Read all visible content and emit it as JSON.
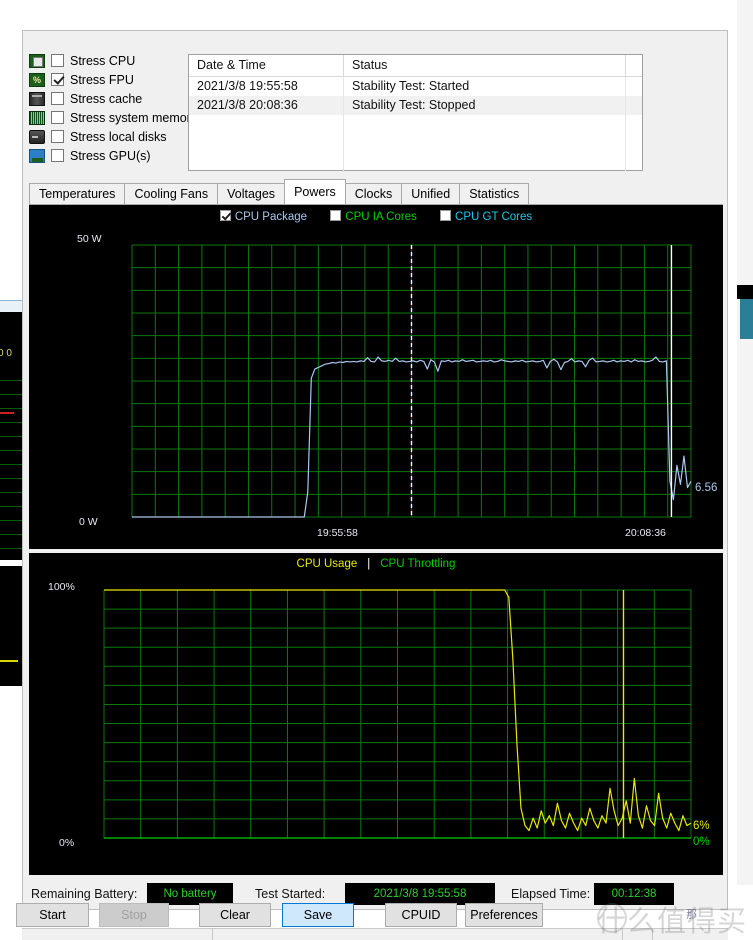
{
  "stress_options": [
    {
      "label": "Stress CPU",
      "checked": false,
      "icon": "cpu-icon"
    },
    {
      "label": "Stress FPU",
      "checked": true,
      "icon": "fpu-icon"
    },
    {
      "label": "Stress cache",
      "checked": false,
      "icon": "cache-icon"
    },
    {
      "label": "Stress system memory",
      "checked": false,
      "icon": "memory-icon"
    },
    {
      "label": "Stress local disks",
      "checked": false,
      "icon": "disk-icon"
    },
    {
      "label": "Stress GPU(s)",
      "checked": false,
      "icon": "gpu-icon"
    }
  ],
  "log": {
    "columns": [
      "Date & Time",
      "Status",
      ""
    ],
    "rows": [
      [
        "2021/3/8 19:55:58",
        "Stability Test: Started",
        ""
      ],
      [
        "2021/3/8 20:08:36",
        "Stability Test: Stopped",
        ""
      ],
      [
        "",
        "",
        ""
      ],
      [
        "",
        "",
        ""
      ],
      [
        "",
        "",
        ""
      ]
    ]
  },
  "tabs": [
    {
      "label": "Temperatures",
      "active": false
    },
    {
      "label": "Cooling Fans",
      "active": false
    },
    {
      "label": "Voltages",
      "active": false
    },
    {
      "label": "Powers",
      "active": true
    },
    {
      "label": "Clocks",
      "active": false
    },
    {
      "label": "Unified",
      "active": false
    },
    {
      "label": "Statistics",
      "active": false
    }
  ],
  "colors": {
    "cpu_package": "#a8c8f0",
    "cpu_ia_cores": "#00d000",
    "cpu_gt_cores": "#20c8f0",
    "cpu_usage": "#e8e800",
    "cpu_throttling": "#00d000",
    "grid": "#0a7a0a",
    "plot_bg": "#000000",
    "axis_text": "#e9e9f5"
  },
  "chart_data": [
    {
      "type": "line",
      "title": "Powers",
      "ylabel": "W",
      "ylim": [
        0,
        50
      ],
      "y_ticks": [
        "0 W",
        "50 W"
      ],
      "x_ticks": [
        "19:55:58",
        "20:08:36"
      ],
      "grid": true,
      "legend": [
        {
          "label": "CPU Package",
          "checked": true,
          "color": "#a8c8f0"
        },
        {
          "label": "CPU IA Cores",
          "checked": false,
          "color": "#00d000"
        },
        {
          "label": "CPU GT Cores",
          "checked": false,
          "color": "#20c8f0"
        }
      ],
      "series": [
        {
          "name": "CPU Package",
          "color": "#a8c8f0",
          "current_value_label": "6.56",
          "values": [
            0,
            0,
            0,
            0,
            0,
            0,
            0,
            0,
            0,
            0,
            0,
            0,
            0,
            0,
            0,
            0,
            0,
            0,
            0,
            0,
            0,
            0,
            0,
            0,
            0,
            0,
            0,
            0,
            0,
            0,
            0,
            0,
            0,
            0,
            0,
            0,
            0,
            0,
            0,
            0,
            0,
            0,
            0,
            0,
            0,
            0,
            0,
            0,
            0,
            0,
            4.6,
            25.5,
            27.2,
            27.5,
            27.8,
            28.1,
            28.2,
            28.4,
            28.3,
            28.5,
            28.4,
            28.6,
            28.5,
            28.6,
            28.5,
            28.7,
            28.6,
            29.3,
            28.6,
            28.5,
            29.4,
            28.7,
            28.6,
            28.8,
            28.6,
            29.2,
            28.6,
            28.7,
            28.5,
            28.6,
            28.7,
            28.5,
            28.8,
            28.6,
            27.2,
            28.9,
            28.5,
            26.8,
            28.7,
            28.6,
            28.8,
            28.5,
            28.7,
            28.6,
            28.9,
            28.6,
            28.7,
            28.8,
            28.5,
            28.6,
            28.7,
            28.6,
            28.8,
            28.5,
            28.6,
            28.9,
            28.7,
            28.6,
            28.5,
            28.7,
            28.6,
            28.8,
            28.5,
            28.6,
            28.7,
            28.5,
            28.6,
            28.8,
            27.4,
            28.6,
            29.0,
            28.5,
            27.1,
            28.4,
            28.6,
            29.1,
            28.5,
            28.7,
            28.6,
            27.6,
            28.8,
            29.2,
            28.5,
            28.6,
            28.7,
            28.5,
            28.6,
            28.8,
            28.5,
            28.7,
            28.6,
            28.8,
            28.5,
            28.9,
            28.6,
            28.7,
            28.5,
            28.6,
            28.8,
            29.4,
            28.6,
            28.5,
            28.7,
            6.56,
            3.2,
            9.5,
            6.0,
            11.2,
            5.4,
            6.56
          ]
        }
      ],
      "marker_lines": [
        {
          "position_ratio": 0.5,
          "style": "dashed",
          "color": "#ffffff"
        },
        {
          "position_ratio": 0.965,
          "style": "solid",
          "color": "#ffffff"
        }
      ]
    },
    {
      "type": "line",
      "title": "CPU Usage | CPU Throttling",
      "ylabel": "%",
      "ylim": [
        0,
        100
      ],
      "y_ticks": [
        "0%",
        "100%"
      ],
      "grid": true,
      "legend": [
        {
          "label": "CPU Usage",
          "color": "#e8e800"
        },
        {
          "label": "CPU Throttling",
          "color": "#00d000"
        }
      ],
      "series": [
        {
          "name": "CPU Usage",
          "color": "#e8e800",
          "current_value_label": "6%",
          "values": [
            100,
            100,
            100,
            100,
            100,
            100,
            100,
            100,
            100,
            100,
            100,
            100,
            100,
            100,
            100,
            100,
            100,
            100,
            100,
            100,
            100,
            100,
            100,
            100,
            100,
            100,
            100,
            100,
            100,
            100,
            100,
            100,
            100,
            100,
            100,
            100,
            100,
            100,
            100,
            100,
            100,
            100,
            100,
            100,
            100,
            100,
            100,
            100,
            100,
            100,
            100,
            100,
            100,
            100,
            100,
            100,
            100,
            100,
            100,
            100,
            100,
            100,
            100,
            100,
            100,
            100,
            100,
            100,
            100,
            100,
            100,
            100,
            100,
            100,
            100,
            100,
            100,
            100,
            100,
            100,
            100,
            100,
            100,
            100,
            100,
            100,
            100,
            100,
            100,
            100,
            100,
            100,
            100,
            100,
            100,
            100,
            100,
            100,
            100,
            100,
            97,
            72,
            38,
            12,
            5,
            3,
            8,
            4,
            11,
            6,
            9,
            5,
            14,
            7,
            4,
            10,
            6,
            3,
            8,
            5,
            12,
            7,
            4,
            9,
            6,
            20,
            11,
            5,
            8,
            15,
            6,
            24,
            9,
            4,
            13,
            7,
            5,
            18,
            8,
            4,
            10,
            6,
            3,
            9,
            5,
            6
          ]
        },
        {
          "name": "CPU Throttling",
          "color": "#00d000",
          "current_value_label": "0%",
          "values": [
            0,
            0,
            0,
            0,
            0,
            0,
            0,
            0,
            0,
            0,
            0,
            0,
            0,
            0,
            0,
            0,
            0,
            0,
            0,
            0,
            0,
            0,
            0,
            0,
            0,
            0,
            0,
            0,
            0,
            0,
            0,
            0,
            0,
            0,
            0,
            0,
            0,
            0,
            0,
            0,
            0,
            0,
            0,
            0,
            0,
            0,
            0,
            0,
            0,
            0,
            0,
            0,
            0,
            0,
            0,
            0,
            0,
            0,
            0,
            0,
            0,
            0,
            0,
            0,
            0,
            0,
            0,
            0,
            0,
            0,
            0,
            0,
            0,
            0,
            0,
            0,
            0,
            0,
            0,
            0,
            0,
            0,
            0,
            0,
            0,
            0,
            0,
            0,
            0,
            0,
            0,
            0,
            0,
            0,
            0,
            0,
            0,
            0,
            0,
            0,
            0,
            0,
            0,
            0,
            0,
            0,
            0,
            0,
            0,
            0,
            0,
            0,
            0,
            0,
            0,
            0,
            0,
            0,
            0,
            0,
            0,
            0,
            0,
            0,
            0,
            0,
            0,
            0,
            0,
            0,
            0,
            0,
            0,
            0,
            0,
            0,
            0,
            0,
            0,
            0,
            0,
            0,
            0,
            0,
            0,
            0,
            0,
            0,
            0,
            0
          ]
        }
      ],
      "marker_lines": [
        {
          "position_ratio": 0.885,
          "style": "solid",
          "color": "#e8e800"
        }
      ]
    }
  ],
  "statusbar": {
    "battery_label": "Remaining Battery:",
    "battery_value": "No battery",
    "started_label": "Test Started:",
    "started_value": "2021/3/8 19:55:58",
    "elapsed_label": "Elapsed Time:",
    "elapsed_value": "00:12:38",
    "value_color": "#2ad02a"
  },
  "buttons": [
    {
      "label": "Start",
      "state": "normal"
    },
    {
      "label": "Stop",
      "state": "disabled"
    },
    {
      "label": "Clear",
      "state": "normal"
    },
    {
      "label": "Save",
      "state": "focused"
    },
    {
      "label": "CPUID",
      "state": "normal"
    },
    {
      "label": "Preferences",
      "state": "normal"
    }
  ],
  "watermark": {
    "text": "什么值得买",
    "small": "那"
  }
}
